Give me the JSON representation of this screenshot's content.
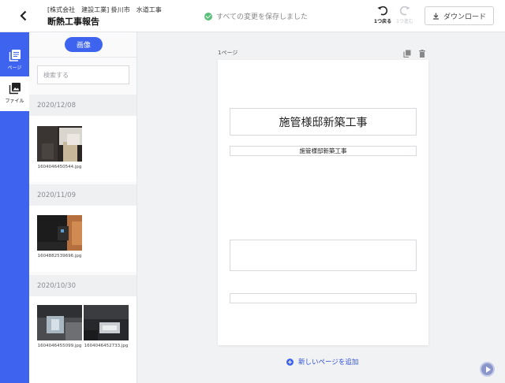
{
  "header": {
    "subtitle": "[株式会社　建設工業] 掛川市　水道工事",
    "title": "断熱工事報告",
    "save_status": "すべての変更を保存しました",
    "undo_label": "1つ戻る",
    "redo_label": "1つ進む",
    "download_label": "ダウンロード"
  },
  "rail": {
    "pages_label": "ページ",
    "files_label": "ファイル"
  },
  "panel": {
    "tab_label": "画像",
    "search_placeholder": "検索する",
    "groups": [
      {
        "date": "2020/12/08",
        "files": [
          "1604046450544.jpg"
        ]
      },
      {
        "date": "2020/11/09",
        "files": [
          "1604882539696.jpg"
        ]
      },
      {
        "date": "2020/10/30",
        "files": [
          "1604046455099.jpg",
          "1604046452733.jpg"
        ]
      }
    ]
  },
  "canvas": {
    "page_label": "1ページ",
    "title_box": "施管様邸新築工事",
    "subtitle_box": "施管様邸新築工事",
    "add_page_label": "新しいページを追加"
  },
  "colors": {
    "accent": "#3e64ef",
    "success": "#5bbf7a"
  }
}
